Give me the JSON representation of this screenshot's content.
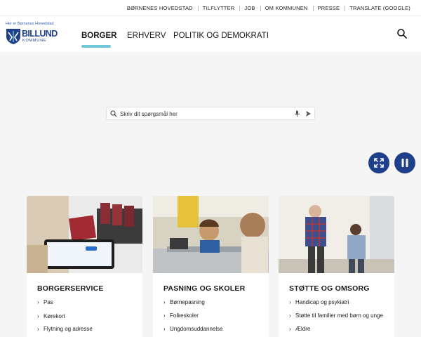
{
  "top_links": [
    "BØRNENES HOVEDSTAD",
    "TILFLYTTER",
    "JOB",
    "OM KOMMUNEN",
    "PRESSE",
    "TRANSLATE (GOOGLE)"
  ],
  "logo": {
    "tagline": "Her er Børnenes Hovedstad",
    "name": "BILLUND",
    "sub": "KOMMUNE"
  },
  "nav": [
    "BORGER",
    "ERHVERV",
    "POLITIK OG DEMOKRATI"
  ],
  "search": {
    "placeholder": "Skriv dit spørgsmål her"
  },
  "cards": [
    {
      "title": "BORGERSERVICE",
      "links": [
        "Pas",
        "Kørekort",
        "Flytning og adresse"
      ]
    },
    {
      "title": "PASNING OG SKOLER",
      "links": [
        "Børnepasning",
        "Folkeskoler",
        "Ungdomsuddannelse"
      ]
    },
    {
      "title": "STØTTE OG OMSORG",
      "links": [
        "Handicap og psykiatri",
        "Støtte til familier med børn og unge",
        "Ældre"
      ]
    }
  ],
  "icons": {
    "search": "search-icon",
    "mic": "microphone-icon",
    "send": "send-arrow-icon",
    "fullscreen": "fullscreen-icon",
    "pause": "pause-icon",
    "chevron": "chevron-right-icon"
  },
  "colors": {
    "brand": "#1f3f8a",
    "accent": "#6ec8d6"
  }
}
